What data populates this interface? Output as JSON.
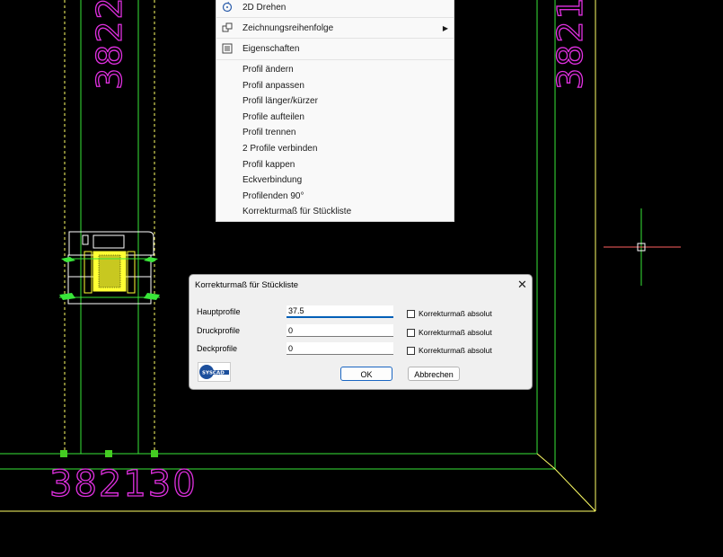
{
  "colors": {
    "bg": "#000000",
    "green": "#39e639",
    "yellow": "#ffff33",
    "magenta": "#e030e0",
    "cursor_red": "#ff5050",
    "accent": "#005fb8"
  },
  "cad": {
    "dim_bottom": "382130",
    "dim_left_vertical": "3822",
    "dim_right_vertical": "3821"
  },
  "context_menu": {
    "items": [
      {
        "label": "2D Drehen",
        "icon": "rotate-2d-icon"
      },
      {
        "label": "Zeichnungsreihenfolge",
        "icon": "draw-order-icon",
        "submenu": true
      },
      {
        "label": "Eigenschaften",
        "icon": "properties-icon"
      },
      {
        "label": "Profil ändern"
      },
      {
        "label": "Profil anpassen"
      },
      {
        "label": "Profil länger/kürzer"
      },
      {
        "label": "Profile aufteilen"
      },
      {
        "label": "Profil trennen"
      },
      {
        "label": "2 Profile verbinden"
      },
      {
        "label": "Profil kappen"
      },
      {
        "label": "Eckverbindung"
      },
      {
        "label": "Profilenden 90°"
      },
      {
        "label": "Korrekturmaß für Stückliste"
      }
    ]
  },
  "dialog": {
    "title": "Korrekturmaß für Stückliste",
    "close": "✕",
    "rows": [
      {
        "label": "Hauptprofile",
        "value": "37.5",
        "checkbox_label": "Korrekturmaß absolut",
        "checked": false
      },
      {
        "label": "Druckprofile",
        "value": "0",
        "checkbox_label": "Korrekturmaß absolut",
        "checked": false
      },
      {
        "label": "Deckprofile",
        "value": "0",
        "checkbox_label": "Korrekturmaß absolut",
        "checked": false
      }
    ],
    "ok_label": "OK",
    "cancel_label": "Abbrechen",
    "logo_text": "SYSCAD"
  }
}
